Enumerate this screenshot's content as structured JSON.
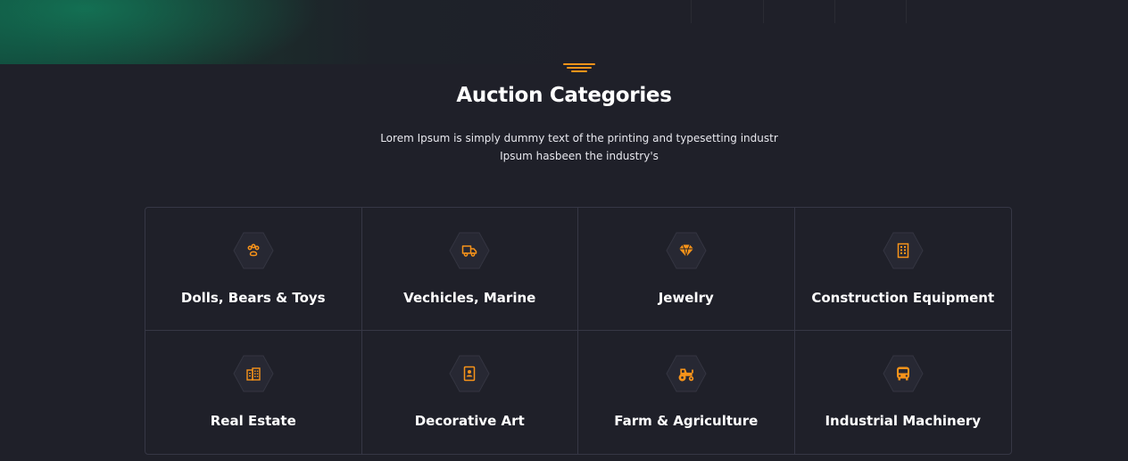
{
  "section": {
    "title": "Auction Categories",
    "subtitle_line1": "Lorem Ipsum is simply dummy text of the printing and typesetting industr",
    "subtitle_line2": "Ipsum hasbeen the industry's"
  },
  "colors": {
    "accent": "#f7931a",
    "background": "#1f2029",
    "border": "#363745",
    "glow": "#137858"
  },
  "categories": [
    {
      "label": "Dolls, Bears & Toys",
      "icon": "paw-icon"
    },
    {
      "label": "Vechicles, Marine",
      "icon": "truck-icon"
    },
    {
      "label": "Jewelry",
      "icon": "diamond-icon"
    },
    {
      "label": "Construction Equipment",
      "icon": "building-icon"
    },
    {
      "label": "Real Estate",
      "icon": "city-icon"
    },
    {
      "label": "Decorative Art",
      "icon": "portrait-icon"
    },
    {
      "label": "Farm & Agriculture",
      "icon": "tractor-icon"
    },
    {
      "label": "Industrial Machinery",
      "icon": "bus-icon"
    }
  ]
}
